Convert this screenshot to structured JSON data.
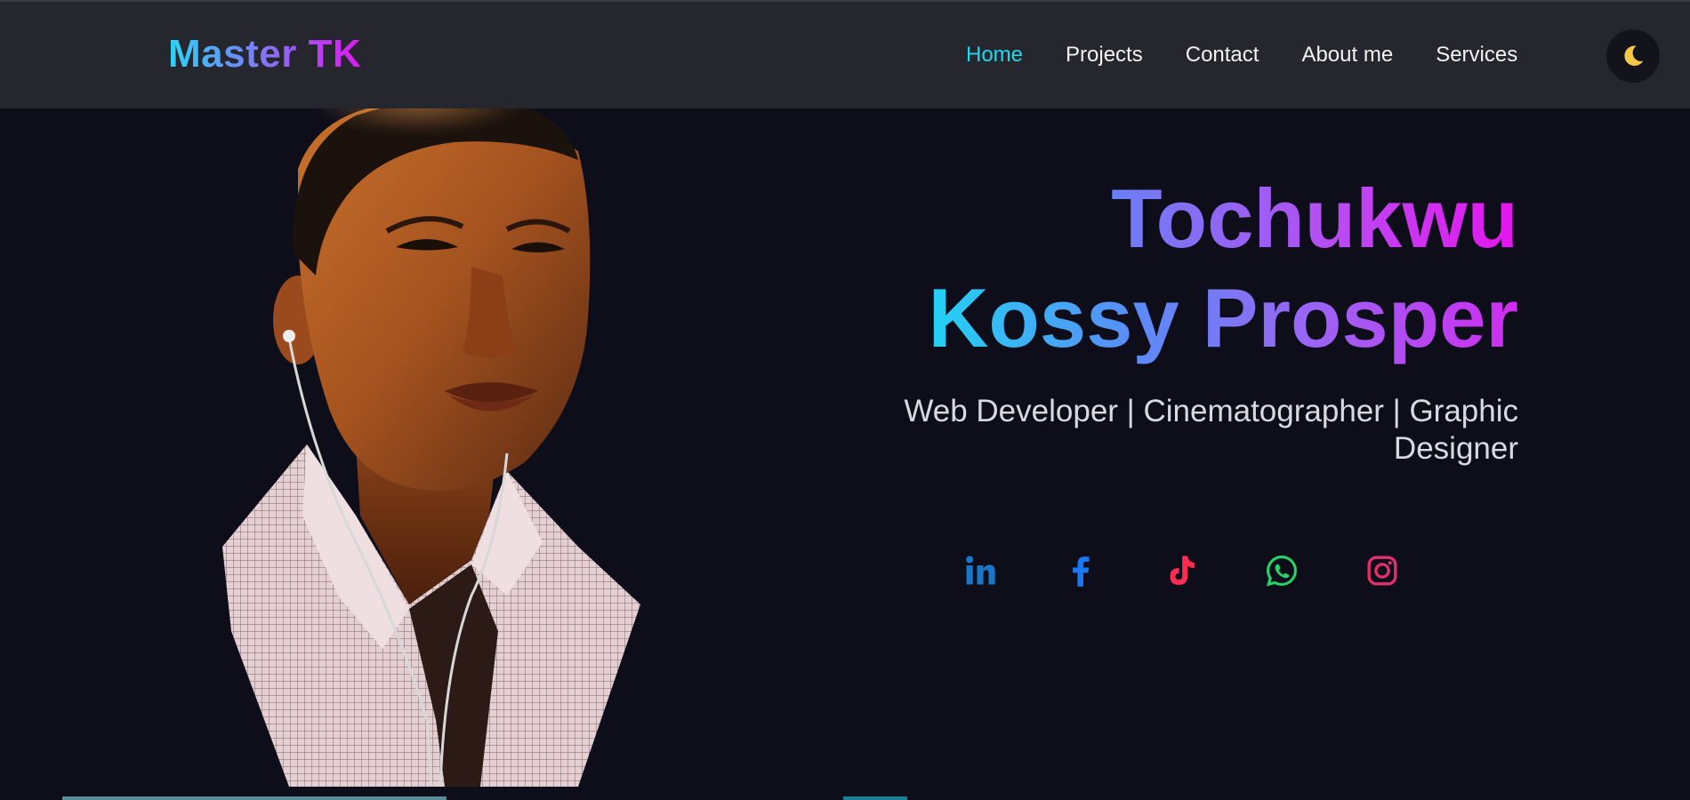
{
  "brand": {
    "logo_text": "Master TK"
  },
  "nav": {
    "items": [
      {
        "label": "Home",
        "active": true
      },
      {
        "label": "Projects",
        "active": false
      },
      {
        "label": "Contact",
        "active": false
      },
      {
        "label": "About me",
        "active": false
      },
      {
        "label": "Services",
        "active": false
      }
    ],
    "theme_toggle_icon": "moon-icon"
  },
  "hero": {
    "first_name": "Tochukwu",
    "last_name": "Kossy Prosper",
    "tagline": "Web Developer | Cinematographer | Graphic Designer",
    "photo_icon": "portrait-photo"
  },
  "socials": [
    {
      "icon": "linkedin-icon",
      "color": "#1877c9"
    },
    {
      "icon": "facebook-icon",
      "color": "#1877f2"
    },
    {
      "icon": "tiktok-icon",
      "color": "#fe2c55"
    },
    {
      "icon": "whatsapp-icon",
      "color": "#25d366"
    },
    {
      "icon": "instagram-icon",
      "color": "#e1306c"
    }
  ],
  "colors": {
    "background": "#0e0e1a",
    "navbar": "#26262f",
    "active_link": "#1fd8ea",
    "gradient_cyan": "#22d3f4",
    "gradient_magenta": "#e614ee"
  }
}
